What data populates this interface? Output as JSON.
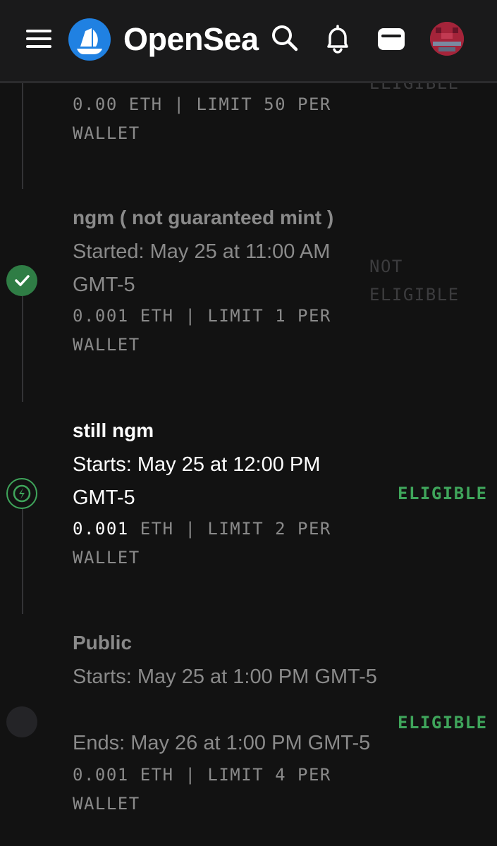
{
  "header": {
    "brand": "OpenSea",
    "icons": [
      "menu-icon",
      "opensea-logo",
      "search-icon",
      "bell-icon",
      "wallet-icon",
      "avatar"
    ]
  },
  "phases": [
    {
      "status": "ELIGIBLE",
      "price_amount": "0.00",
      "price_rest": "ETH | LIMIT 50 PER WALLET"
    },
    {
      "name": "ngm ( not guaranteed mint )",
      "time": "Started: May 25 at 11:00 AM GMT-5",
      "price_amount": "0.001",
      "price_rest": "ETH | LIMIT 1 PER WALLET",
      "status": "NOT ELIGIBLE",
      "state": "completed"
    },
    {
      "name": "still ngm",
      "time": "Starts: May 25 at 12:00 PM GMT-5",
      "price_amount": "0.001",
      "price_rest": "ETH | LIMIT 2 PER WALLET",
      "status": "ELIGIBLE",
      "state": "upcoming"
    },
    {
      "name": "Public",
      "time": "Starts: May 25 at 1:00 PM GMT-5",
      "end_time": "Ends: May 26 at 1:00 PM GMT-5",
      "price_amount": "0.001",
      "price_rest": "ETH | LIMIT 4 PER WALLET",
      "status": "ELIGIBLE",
      "state": "pending"
    }
  ],
  "colors": {
    "background": "#121212",
    "header": "#1a1a1b",
    "brand_blue": "#2081e2",
    "eligible_green": "#3fa55b",
    "muted_text": "#8a8a8a"
  }
}
